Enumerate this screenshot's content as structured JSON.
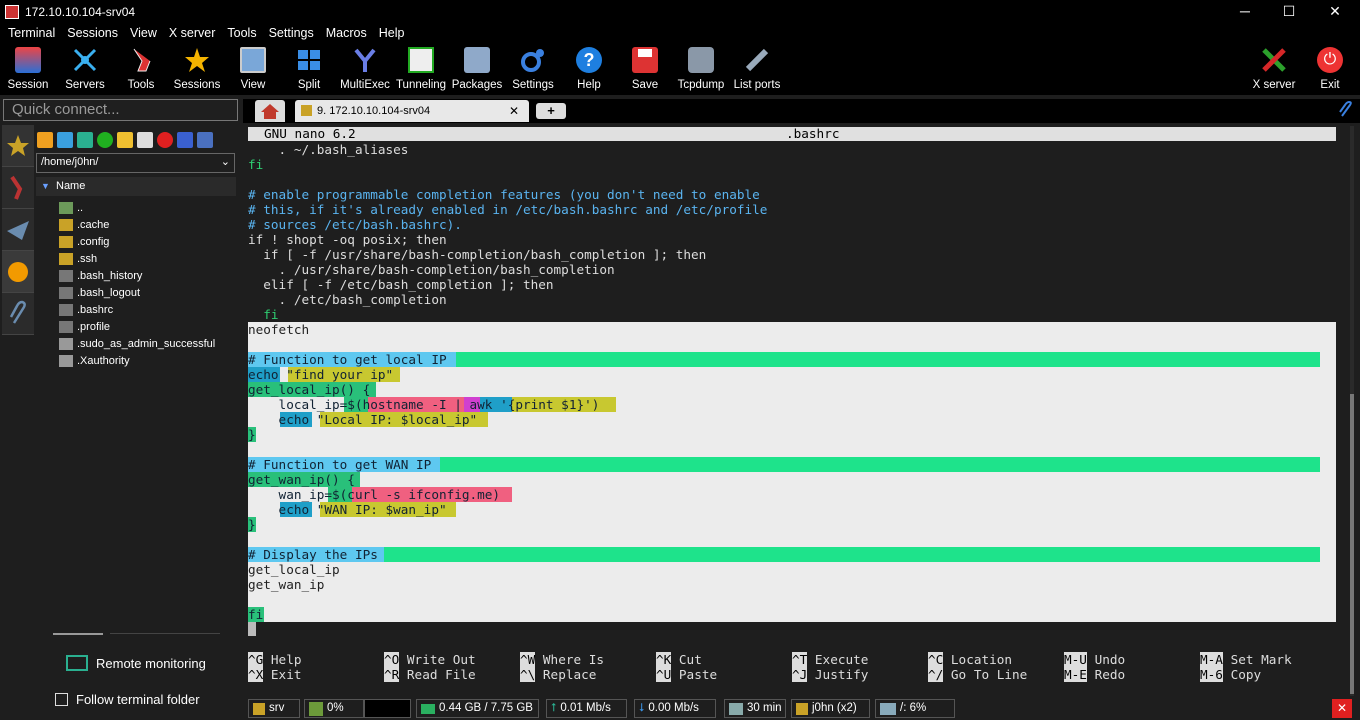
{
  "window": {
    "title": "172.10.10.104-srv04",
    "min": "─",
    "max": "☐",
    "close": "✕"
  },
  "menu": [
    "Terminal",
    "Sessions",
    "View",
    "X server",
    "Tools",
    "Settings",
    "Macros",
    "Help"
  ],
  "toolbar": [
    "Session",
    "Servers",
    "Tools",
    "Sessions",
    "View",
    "Split",
    "MultiExec",
    "Tunneling",
    "Packages",
    "Settings",
    "Help",
    "Save",
    "Tcpdump",
    "List ports",
    "X server",
    "Exit"
  ],
  "quick_connect_placeholder": "Quick connect...",
  "sidebar": {
    "path": "/home/j0hn/",
    "column": "Name",
    "files": [
      "..",
      ".cache",
      ".config",
      ".ssh",
      ".bash_history",
      ".bash_logout",
      ".bashrc",
      ".profile",
      ".sudo_as_admin_successful",
      ".Xauthority"
    ],
    "remote_monitoring": "Remote monitoring",
    "follow_folder": "Follow terminal folder"
  },
  "tab": {
    "label": "9. 172.10.10.104-srv04",
    "close": "✕",
    "add": "+"
  },
  "nano": {
    "header_left": "GNU nano 6.2",
    "header_center": ".bashrc",
    "lines": [
      "    . ~/.bash_aliases",
      "fi",
      "",
      "# enable programmable completion features (you don't need to enable",
      "# this, if it's already enabled in /etc/bash.bashrc and /etc/profile",
      "# sources /etc/bash.bashrc).",
      "if ! shopt -oq posix; then",
      "  if [ -f /usr/share/bash-completion/bash_completion ]; then",
      "    . /usr/share/bash-completion/bash_completion",
      "  elif [ -f /etc/bash_completion ]; then",
      "    . /etc/bash_completion",
      "  fi",
      "neofetch",
      "",
      "# Function to get local IP",
      "echo \"find your ip\"",
      "get_local_ip() {",
      "    local_ip=$(hostname -I | awk '{print $1}')",
      "    echo \"Local IP: $local_ip\"",
      "}",
      "",
      "# Function to get WAN IP",
      "get_wan_ip() {",
      "    wan_ip=$(curl -s ifconfig.me)",
      "    echo \"WAN IP: $wan_ip\"",
      "}",
      "",
      "# Display the IPs",
      "get_local_ip",
      "get_wan_ip",
      "",
      "fi"
    ],
    "shortcuts": [
      {
        "k1": "^G",
        "l1": "Help",
        "k2": "^X",
        "l2": "Exit"
      },
      {
        "k1": "^O",
        "l1": "Write Out",
        "k2": "^R",
        "l2": "Read File"
      },
      {
        "k1": "^W",
        "l1": "Where Is",
        "k2": "^\\",
        "l2": "Replace"
      },
      {
        "k1": "^K",
        "l1": "Cut",
        "k2": "^U",
        "l2": "Paste"
      },
      {
        "k1": "^T",
        "l1": "Execute",
        "k2": "^J",
        "l2": "Justify"
      },
      {
        "k1": "^C",
        "l1": "Location",
        "k2": "^/",
        "l2": "Go To Line"
      },
      {
        "k1": "M-U",
        "l1": "Undo",
        "k2": "M-E",
        "l2": "Redo"
      },
      {
        "k1": "M-A",
        "l1": "Set Mark",
        "k2": "M-6",
        "l2": "Copy"
      }
    ]
  },
  "status": {
    "srv": "srv",
    "cpu": "0%",
    "mem": "0.44 GB / 7.75 GB",
    "up": "0.01 Mb/s",
    "down": "0.00 Mb/s",
    "time": "30 min",
    "user": "j0hn (x2)",
    "disk": "/: 6%"
  }
}
